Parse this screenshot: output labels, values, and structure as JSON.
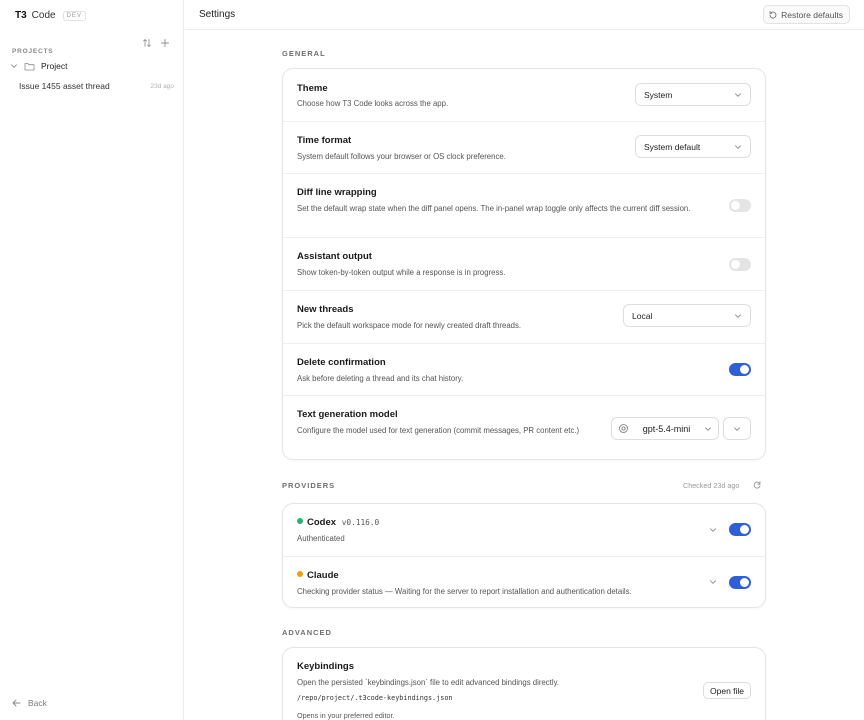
{
  "sidebar": {
    "brand_t3": "T3",
    "brand_code": "Code",
    "brand_dev": "DEV",
    "projects_label": "PROJECTS",
    "project_name": "Project",
    "thread_name": "Issue 1455 asset thread",
    "thread_age": "23d ago",
    "back_label": "Back"
  },
  "header": {
    "title": "Settings",
    "restore_label": "Restore defaults"
  },
  "general": {
    "section_label": "GENERAL",
    "theme": {
      "title": "Theme",
      "desc": "Choose how T3 Code looks across the app.",
      "value": "System"
    },
    "time_format": {
      "title": "Time format",
      "desc": "System default follows your browser or OS clock preference.",
      "value": "System default"
    },
    "diff_wrap": {
      "title": "Diff line wrapping",
      "desc": "Set the default wrap state when the diff panel opens. The in-panel wrap toggle only affects the current diff session.",
      "enabled": false
    },
    "assistant_output": {
      "title": "Assistant output",
      "desc": "Show token-by-token output while a response is in progress.",
      "enabled": false
    },
    "new_threads": {
      "title": "New threads",
      "desc": "Pick the default workspace mode for newly created draft threads.",
      "value": "Local"
    },
    "delete_confirm": {
      "title": "Delete confirmation",
      "desc": "Ask before deleting a thread and its chat history.",
      "enabled": true
    },
    "text_model": {
      "title": "Text generation model",
      "desc": "Configure the model used for text generation (commit messages, PR content etc.)",
      "value": "gpt-5.4-mini"
    }
  },
  "providers": {
    "section_label": "PROVIDERS",
    "checked_label": "Checked 23d ago",
    "codex": {
      "name": "Codex",
      "version": "v0.116.0",
      "status": "Authenticated",
      "dot_color": "#22b573",
      "enabled": true
    },
    "claude": {
      "name": "Claude",
      "status": "Checking provider status — Waiting for the server to report installation and authentication details.",
      "dot_color": "#f59e0b",
      "enabled": true
    }
  },
  "advanced": {
    "section_label": "ADVANCED",
    "keybindings": {
      "title": "Keybindings",
      "desc": "Open the persisted `keybindings.json` file to edit advanced bindings directly.",
      "path": "/repo/project/.t3code-keybindings.json",
      "note": "Opens in your preferred editor.",
      "button": "Open file"
    }
  },
  "colors": {
    "accent": "#2f5fd6",
    "toggle_off": "#e4e4e4",
    "border": "#e5e5e5"
  }
}
